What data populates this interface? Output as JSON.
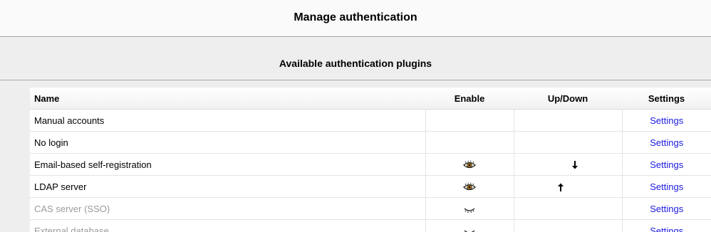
{
  "header": {
    "title": "Manage authentication"
  },
  "section": {
    "title": "Available authentication plugins"
  },
  "table": {
    "columns": {
      "name": "Name",
      "enable": "Enable",
      "updown": "Up/Down",
      "settings": "Settings"
    },
    "rows": [
      {
        "name": "Manual accounts",
        "enable_icon": "none",
        "updown_icon": "none",
        "settings": "Settings",
        "disabled": false
      },
      {
        "name": "No login",
        "enable_icon": "none",
        "updown_icon": "none",
        "settings": "Settings",
        "disabled": false
      },
      {
        "name": "Email-based self-registration",
        "enable_icon": "eye-open-icon",
        "updown_icon": "arrow-down-icon",
        "settings": "Settings",
        "disabled": false
      },
      {
        "name": "LDAP server",
        "enable_icon": "eye-open-icon",
        "updown_icon": "arrow-up-icon",
        "settings": "Settings",
        "disabled": false
      },
      {
        "name": "CAS server (SSO)",
        "enable_icon": "eye-closed-icon",
        "updown_icon": "none",
        "settings": "Settings",
        "disabled": true
      },
      {
        "name": "External database",
        "enable_icon": "eye-closed-icon",
        "updown_icon": "none",
        "settings": "Settings",
        "disabled": true
      }
    ]
  },
  "colors": {
    "link": "#1a1ae0",
    "disabled_text": "#9a9a9a",
    "background": "#eeeeee"
  }
}
